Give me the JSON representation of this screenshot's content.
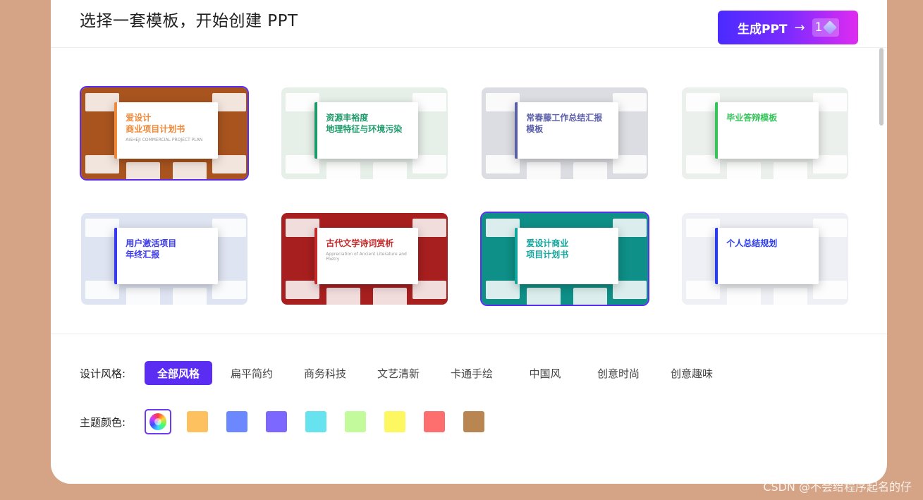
{
  "header": {
    "title": "选择一套模板，开始创建 PPT",
    "generate_label": "生成PPT",
    "generate_arrow": "→",
    "generate_count": "1"
  },
  "templates": [
    {
      "title": "爱设计\n商业项目计划书",
      "subtitle": "AISHEJI COMMERCIAL PROJECT PLAN",
      "selected": true,
      "accent": "#f08a3a",
      "bg": "#a9541f"
    },
    {
      "title": "资源丰裕度\n地理特征与环境污染",
      "subtitle": "",
      "selected": false,
      "accent": "#1c9a6a",
      "bg": "#e7efe9"
    },
    {
      "title": "常春藤工作总结汇报模板",
      "subtitle": "",
      "selected": false,
      "accent": "#5b5fa8",
      "bg": "#dcdde2"
    },
    {
      "title": "毕业答辩模板",
      "subtitle": "",
      "selected": false,
      "accent": "#35c45a",
      "bg": "#ecf0ec"
    },
    {
      "title": "用户激活项目\n年终汇报",
      "subtitle": "",
      "selected": false,
      "accent": "#3a3af0",
      "bg": "#dfe4f2"
    },
    {
      "title": "古代文学诗词赏析",
      "subtitle": "Appreciation of Ancient Literature and Poetry",
      "selected": false,
      "accent": "#c42a2a",
      "bg": "#a81f1f"
    },
    {
      "title": "爱设计商业\n项目计划书",
      "subtitle": "",
      "selected": true,
      "accent": "#11a59c",
      "bg": "#0e8f87"
    },
    {
      "title": "个人总结规划",
      "subtitle": "",
      "selected": false,
      "accent": "#2b3cf0",
      "bg": "#eef0f5"
    }
  ],
  "filters": {
    "style_label": "设计风格:",
    "styles": [
      "全部风格",
      "扁平简约",
      "商务科技",
      "文艺清新",
      "卡通手绘",
      "中国风",
      "创意时尚",
      "创意趣味"
    ],
    "active_style": 0,
    "color_label": "主题颜色:",
    "colors": [
      "#fec15f",
      "#6c88ff",
      "#7d68ff",
      "#66e3ef",
      "#c3fb9c",
      "#fdf861",
      "#fd6e6e",
      "#b98651"
    ]
  },
  "watermark": "CSDN @不会给程序起名的仔"
}
